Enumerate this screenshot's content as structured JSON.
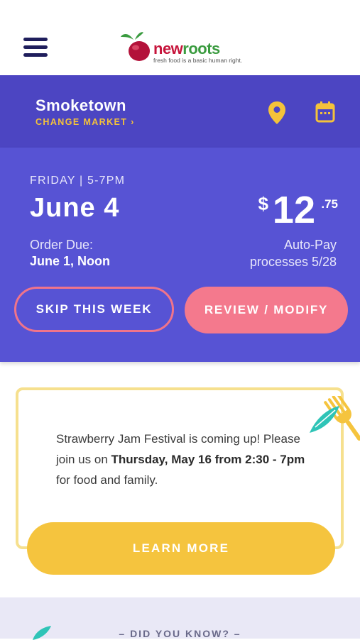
{
  "header": {
    "menu_icon": "hamburger-menu-icon",
    "logo": {
      "brand_part1": "new",
      "brand_part2": "roots",
      "tagline": "fresh food is a basic human right."
    }
  },
  "market": {
    "name": "Smoketown",
    "change_label": "CHANGE MARKET ›",
    "icons": [
      "location-pin-icon",
      "calendar-icon"
    ]
  },
  "order": {
    "day_time": "FRIDAY  |  5-7PM",
    "date": "June 4",
    "due_label": "Order Due:",
    "due_date": "June 1,  Noon",
    "price": {
      "currency": "$",
      "dollars": "12",
      "cents": ".75"
    },
    "autopay_line1": "Auto-Pay",
    "autopay_line2": "processes 5/28",
    "skip_label": "SKIP THIS WEEK",
    "review_label": "REVIEW / MODIFY"
  },
  "promo": {
    "text_part1": "Strawberry Jam Festival is coming up! Please join us on ",
    "text_bold1": "Thursday, May 16 from 2:30 - 7pm",
    "text_part2": " for food and family.",
    "button_label": "LEARN MORE"
  },
  "did_you_know": {
    "title": "– DID YOU KNOW? –"
  },
  "colors": {
    "market_bg": "#4c45c2",
    "order_bg": "#5753d4",
    "accent_yellow": "#f4c23a",
    "accent_pink": "#f4798d",
    "logo_red": "#c6143b",
    "logo_green": "#3a9b3f"
  }
}
